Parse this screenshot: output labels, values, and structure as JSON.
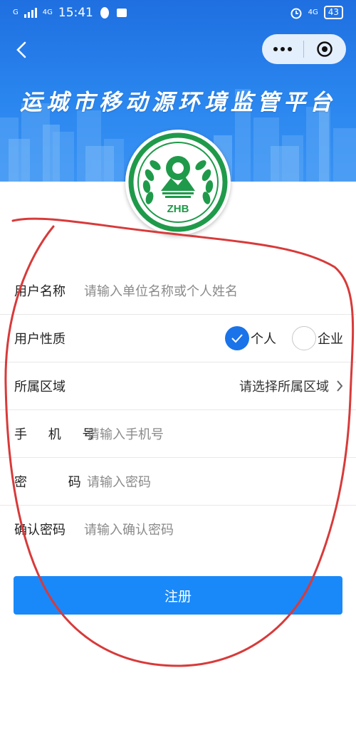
{
  "status_bar": {
    "time": "15:41",
    "signal_label": "4G",
    "network_left": "G",
    "network_right": "4G",
    "battery": "43"
  },
  "header": {
    "title": "运城市移动源环境监管平台",
    "logo_text": "ZHB"
  },
  "form": {
    "username": {
      "label": "用户名称",
      "placeholder": "请输入单位名称或个人姓名"
    },
    "user_type": {
      "label": "用户性质",
      "options": [
        {
          "label": "个人",
          "selected": true
        },
        {
          "label": "企业",
          "selected": false
        }
      ]
    },
    "region": {
      "label": "所属区域",
      "value": "请选择所属区域"
    },
    "phone": {
      "label": "手 机 号",
      "placeholder": "请输入手机号"
    },
    "password": {
      "label": "密 码",
      "placeholder": "请输入密码"
    },
    "confirm_password": {
      "label": "确认密码",
      "placeholder": "请输入确认密码"
    }
  },
  "submit_label": "注册",
  "colors": {
    "header_blue": "#2a86ef",
    "button_blue": "#1989fa",
    "radio_selected": "#1a73e8",
    "logo_green": "#1f9a4a",
    "annotation_red": "#d83a3a"
  }
}
